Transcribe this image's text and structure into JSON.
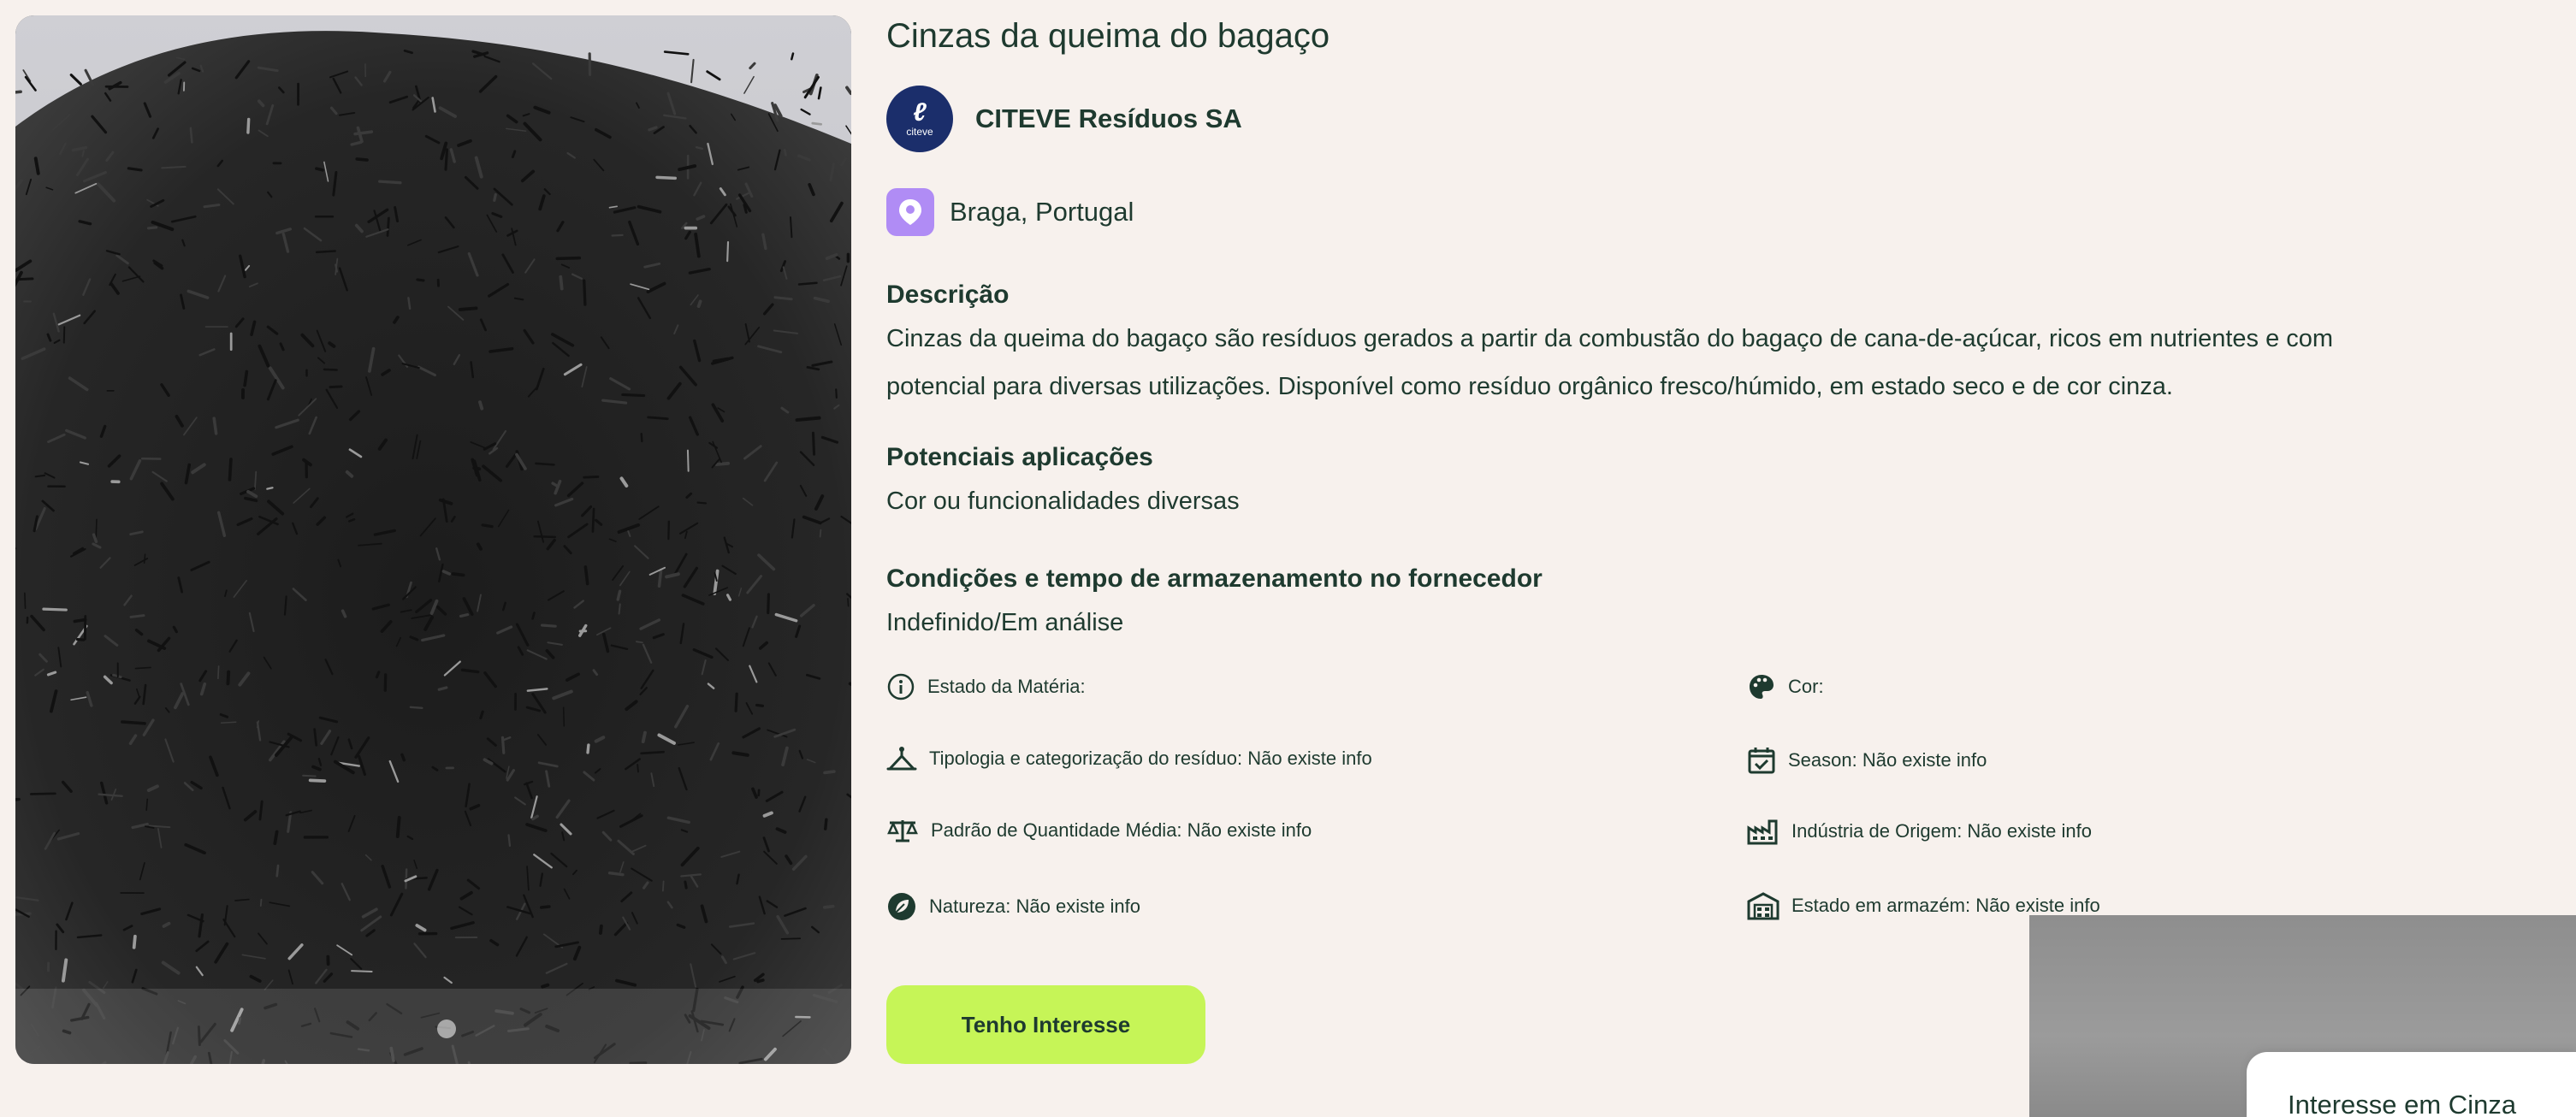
{
  "product": {
    "title": "Cinzas da queima do bagaço",
    "company_logo_text": "citeve",
    "company": "CITEVE Resíduos SA",
    "location": "Braga, Portugal"
  },
  "description": {
    "heading": "Descrição",
    "line1": "Cinzas da queima do bagaço são resíduos gerados a partir da combustão do bagaço de cana-de-açúcar, ricos em nutrientes e com",
    "line2": "potencial para diversas utilizações. Disponível como resíduo orgânico fresco/húmido, em estado seco e de cor cinza."
  },
  "applications": {
    "heading": "Potenciais aplicações",
    "text": "Cor ou funcionalidades diversas"
  },
  "storage": {
    "heading": "Condições e tempo de armazenamento no fornecedor",
    "text": "Indefinido/Em análise"
  },
  "attributes": [
    {
      "label": "Estado da Matéria:",
      "icon": "info-circle-icon"
    },
    {
      "label": "Cor:",
      "icon": "palette-icon"
    },
    {
      "label": "Tipologia e categorização do resíduo: Não existe info",
      "icon": "category-icon"
    },
    {
      "label": "Season: Não existe info",
      "icon": "calendar-check-icon"
    },
    {
      "label": "Padrão de Quantidade Média: Não existe info",
      "icon": "scale-icon"
    },
    {
      "label": "Indústria de Origem: Não existe info",
      "icon": "factory-icon"
    },
    {
      "label": "Natureza: Não existe info",
      "icon": "leaf-icon"
    },
    {
      "label": "Estado em armazém: Não existe info",
      "icon": "warehouse-icon"
    }
  ],
  "cta": {
    "label": "Tenho Interesse"
  },
  "popover": {
    "text": "Interesse em Cinza"
  },
  "colors": {
    "background": "#f7f1ed",
    "cta": "#c6f557",
    "pin": "#b08cf5",
    "logo": "#1b2e6b",
    "text": "#1e3a2f"
  }
}
